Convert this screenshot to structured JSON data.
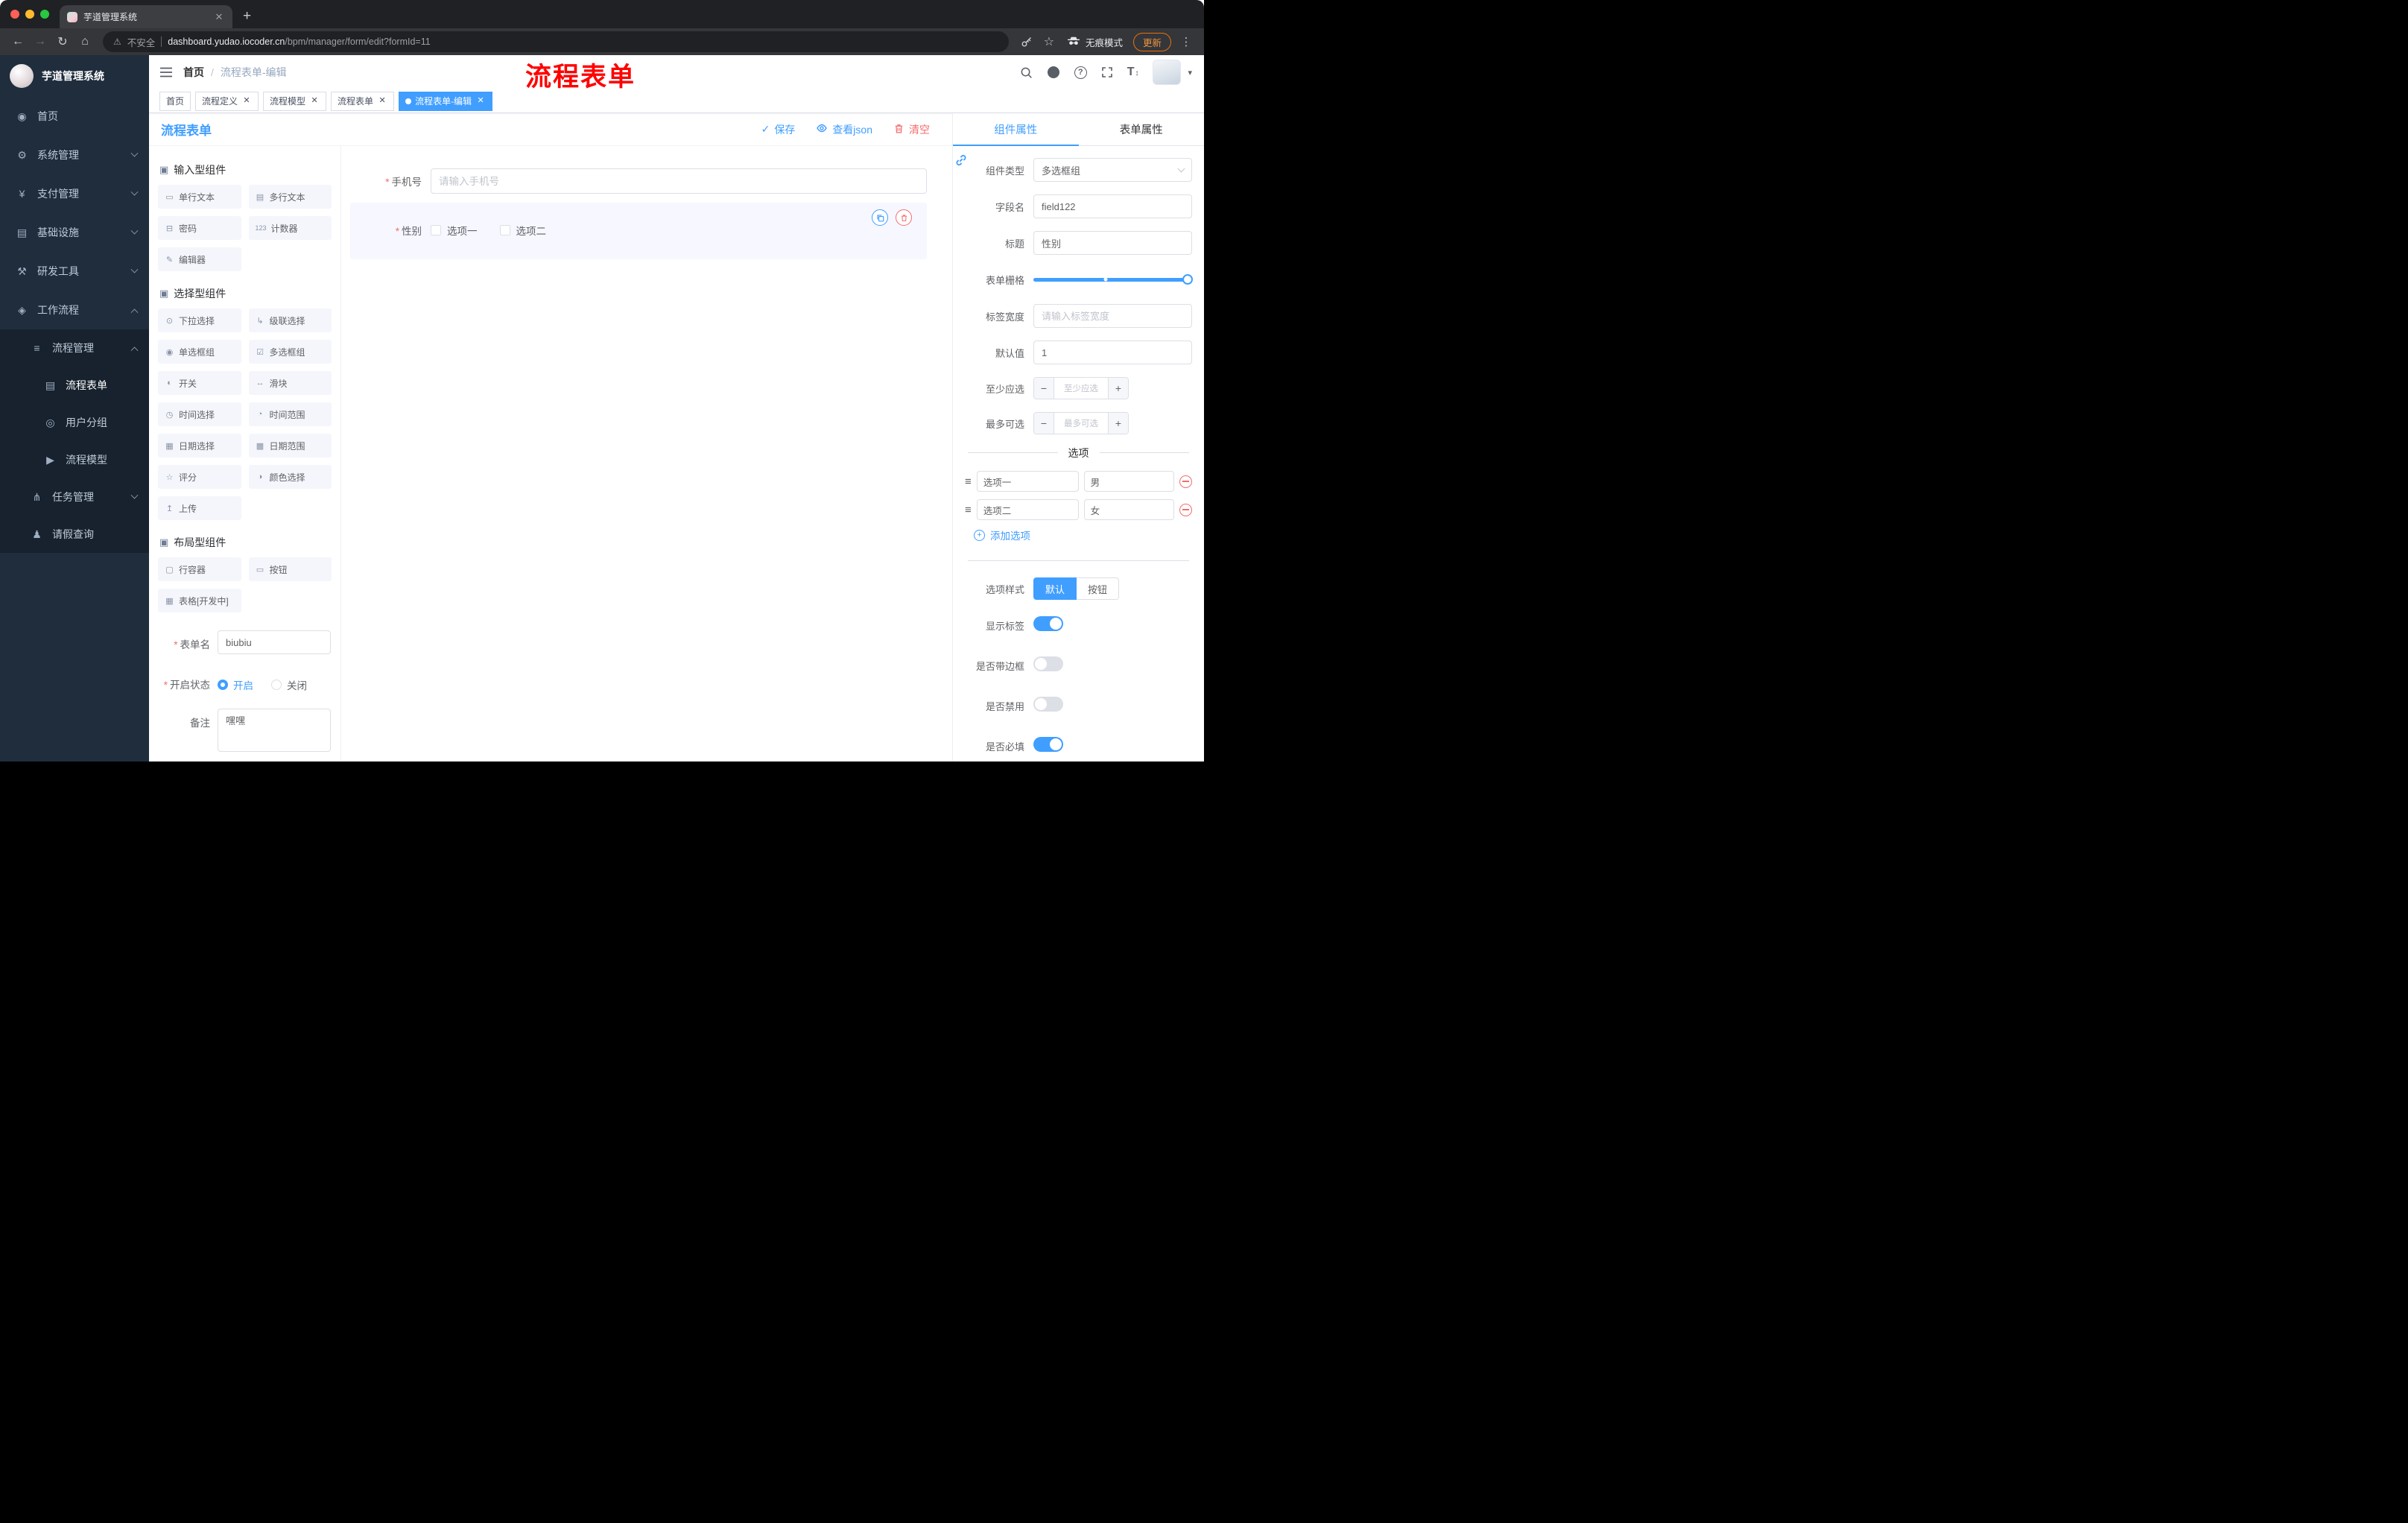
{
  "colors": {
    "accent": "#409eff",
    "danger": "#f56c6c",
    "annotation_red": "#fe0100",
    "update_orange": "#e8710a",
    "sidebar_bg": "#1f2d3d",
    "selected_block_bg": "#f6f7ff"
  },
  "icons": {
    "close": "✕",
    "newtab": "+",
    "back": "←",
    "forward": "→",
    "reload": "↻",
    "home": "⌂",
    "warning": "⚠",
    "star": "☆",
    "kebab": "⋮",
    "check": "✓",
    "question": "?",
    "size_t": "T",
    "size_small": "↕",
    "caret": "▾",
    "drag": "≡",
    "minus": "−",
    "plus_small": "+"
  },
  "chrome": {
    "tab_title": "芋道管理系统",
    "security_label": "不安全",
    "url_domain": "dashboard.yudao.iocoder.cn",
    "url_path": "/bpm/manager/form/edit?formId=11",
    "incognito_label": "无痕模式",
    "update_label": "更新"
  },
  "sidebar": {
    "title": "芋道管理系统",
    "menu": [
      {
        "icon": "◉",
        "label": "首页"
      },
      {
        "icon": "⚙",
        "label": "系统管理"
      },
      {
        "icon": "¥",
        "label": "支付管理"
      },
      {
        "icon": "▤",
        "label": "基础设施"
      },
      {
        "icon": "⚒",
        "label": "研发工具"
      },
      {
        "icon": "◈",
        "label": "工作流程"
      },
      {
        "icon": "≡",
        "label": "流程管理"
      },
      {
        "icon": "▤",
        "label": "流程表单"
      },
      {
        "icon": "◎",
        "label": "用户分组"
      },
      {
        "icon": "▶",
        "label": "流程模型"
      },
      {
        "icon": "⋔",
        "label": "任务管理"
      },
      {
        "icon": "♟",
        "label": "请假查询"
      }
    ]
  },
  "header": {
    "breadcrumb_home": "首页",
    "breadcrumb_sep": "/",
    "breadcrumb_current": "流程表单-编辑",
    "annotation": "流程表单"
  },
  "tags": [
    "首页",
    "流程定义",
    "流程模型",
    "流程表单",
    "流程表单-编辑"
  ],
  "designer": {
    "title": "流程表单",
    "save": "保存",
    "view_json": "查看json",
    "clear": "清空",
    "sections": [
      {
        "icon": "▣",
        "title": "输入型组件",
        "items": [
          {
            "icon": "▭",
            "label": "单行文本"
          },
          {
            "icon": "▤",
            "label": "多行文本"
          },
          {
            "icon": "⊟",
            "label": "密码"
          },
          {
            "icon": "123",
            "label": "计数器"
          },
          {
            "icon": "✎",
            "label": "编辑器"
          }
        ]
      },
      {
        "icon": "▣",
        "title": "选择型组件",
        "items": [
          {
            "icon": "⊙",
            "label": "下拉选择"
          },
          {
            "icon": "↳",
            "label": "级联选择"
          },
          {
            "icon": "◉",
            "label": "单选框组"
          },
          {
            "icon": "☑",
            "label": "多选框组"
          },
          {
            "icon": "◐",
            "label": "开关"
          },
          {
            "icon": "↔",
            "label": "滑块"
          },
          {
            "icon": "◷",
            "label": "时间选择"
          },
          {
            "icon": "◔",
            "label": "时间范围"
          },
          {
            "icon": "▦",
            "label": "日期选择"
          },
          {
            "icon": "▩",
            "label": "日期范围"
          },
          {
            "icon": "☆",
            "label": "评分"
          },
          {
            "icon": "◑",
            "label": "颜色选择"
          },
          {
            "icon": "↥",
            "label": "上传"
          }
        ]
      },
      {
        "icon": "▣",
        "title": "布局型组件",
        "items": [
          {
            "icon": "▢",
            "label": "行容器"
          },
          {
            "icon": "▭",
            "label": "按钮"
          },
          {
            "icon": "▦",
            "label": "表格[开发中]"
          }
        ]
      }
    ],
    "meta": {
      "form_name_label": "表单名",
      "form_name_value": "biubiu",
      "status_label": "开启状态",
      "status_on": "开启",
      "status_off": "关闭",
      "remark_label": "备注",
      "remark_value": "嘿嘿"
    },
    "canvas": {
      "phone_label": "手机号",
      "phone_placeholder": "请输入手机号",
      "gender_label": "性别",
      "gender_option1": "选项一",
      "gender_option2": "选项二"
    }
  },
  "props": {
    "tab_component": "组件属性",
    "tab_form": "表单属性",
    "type_label": "组件类型",
    "type_value": "多选框组",
    "field_label": "字段名",
    "field_value": "field122",
    "title_label": "标题",
    "title_value": "性别",
    "grid_label": "表单栅格",
    "width_label": "标签宽度",
    "width_placeholder": "请输入标签宽度",
    "default_label": "默认值",
    "default_value": "1",
    "min_label": "至少应选",
    "min_placeholder": "至少应选",
    "max_label": "最多可选",
    "max_placeholder": "最多可选",
    "options_title": "选项",
    "options": [
      {
        "label": "选项一",
        "value": "男"
      },
      {
        "label": "选项二",
        "value": "女"
      }
    ],
    "add_option": "添加选项",
    "style_label": "选项样式",
    "style_default": "默认",
    "style_button": "按钮",
    "toggles": [
      {
        "label": "显示标签",
        "on": true
      },
      {
        "label": "是否带边框",
        "on": false
      },
      {
        "label": "是否禁用",
        "on": false
      },
      {
        "label": "是否必填",
        "on": true
      }
    ]
  }
}
